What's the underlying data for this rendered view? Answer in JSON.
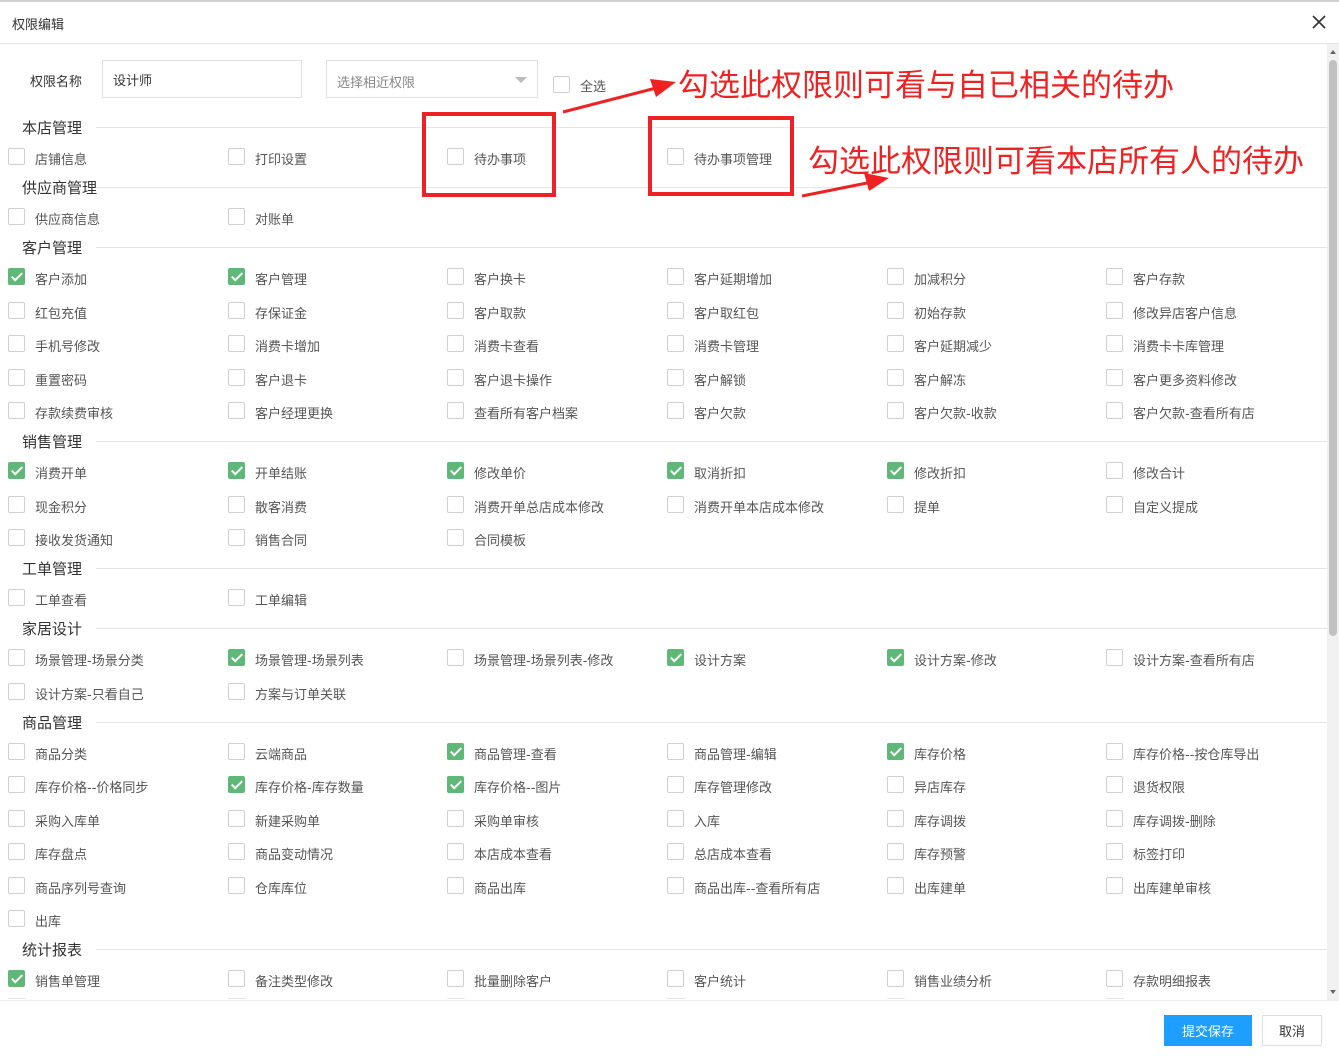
{
  "dialog": {
    "title": "权限编辑",
    "name_label": "权限名称",
    "name_value": "设计师",
    "select_placeholder": "选择相近权限",
    "select_all_label": "全选",
    "submit_label": "提交保存",
    "cancel_label": "取消"
  },
  "annotations": {
    "top": "勾选此权限则可看与自已相关的待办",
    "bottom": "勾选此权限则可看本店所有人的待办",
    "color": "#ee2222"
  },
  "colors": {
    "checked": "#5fb878",
    "primary_button": "#1e9fff"
  },
  "sections": [
    {
      "title": "本店管理",
      "rows": [
        [
          {
            "label": "店铺信息",
            "checked": false
          },
          {
            "label": "打印设置",
            "checked": false
          },
          {
            "label": "待办事项",
            "checked": false
          },
          {
            "label": "待办事项管理",
            "checked": false
          }
        ]
      ]
    },
    {
      "title": "供应商管理",
      "rows": [
        [
          {
            "label": "供应商信息",
            "checked": false
          },
          {
            "label": "对账单",
            "checked": false
          }
        ]
      ]
    },
    {
      "title": "客户管理",
      "rows": [
        [
          {
            "label": "客户添加",
            "checked": true
          },
          {
            "label": "客户管理",
            "checked": true
          },
          {
            "label": "客户换卡",
            "checked": false
          },
          {
            "label": "客户延期增加",
            "checked": false
          },
          {
            "label": "加减积分",
            "checked": false
          },
          {
            "label": "客户存款",
            "checked": false
          }
        ],
        [
          {
            "label": "红包充值",
            "checked": false
          },
          {
            "label": "存保证金",
            "checked": false
          },
          {
            "label": "客户取款",
            "checked": false
          },
          {
            "label": "客户取红包",
            "checked": false
          },
          {
            "label": "初始存款",
            "checked": false
          },
          {
            "label": "修改异店客户信息",
            "checked": false
          }
        ],
        [
          {
            "label": "手机号修改",
            "checked": false
          },
          {
            "label": "消费卡增加",
            "checked": false
          },
          {
            "label": "消费卡查看",
            "checked": false
          },
          {
            "label": "消费卡管理",
            "checked": false
          },
          {
            "label": "客户延期减少",
            "checked": false
          },
          {
            "label": "消费卡卡库管理",
            "checked": false
          }
        ],
        [
          {
            "label": "重置密码",
            "checked": false
          },
          {
            "label": "客户退卡",
            "checked": false
          },
          {
            "label": "客户退卡操作",
            "checked": false
          },
          {
            "label": "客户解锁",
            "checked": false
          },
          {
            "label": "客户解冻",
            "checked": false
          },
          {
            "label": "客户更多资料修改",
            "checked": false
          }
        ],
        [
          {
            "label": "存款续费审核",
            "checked": false
          },
          {
            "label": "客户经理更换",
            "checked": false
          },
          {
            "label": "查看所有客户档案",
            "checked": false
          },
          {
            "label": "客户欠款",
            "checked": false
          },
          {
            "label": "客户欠款-收款",
            "checked": false
          },
          {
            "label": "客户欠款-查看所有店",
            "checked": false
          }
        ]
      ]
    },
    {
      "title": "销售管理",
      "rows": [
        [
          {
            "label": "消费开单",
            "checked": true
          },
          {
            "label": "开单结账",
            "checked": true
          },
          {
            "label": "修改单价",
            "checked": true
          },
          {
            "label": "取消折扣",
            "checked": true
          },
          {
            "label": "修改折扣",
            "checked": true
          },
          {
            "label": "修改合计",
            "checked": false
          }
        ],
        [
          {
            "label": "现金积分",
            "checked": false
          },
          {
            "label": "散客消费",
            "checked": false
          },
          {
            "label": "消费开单总店成本修改",
            "checked": false
          },
          {
            "label": "消费开单本店成本修改",
            "checked": false
          },
          {
            "label": "提单",
            "checked": false
          },
          {
            "label": "自定义提成",
            "checked": false
          }
        ],
        [
          {
            "label": "接收发货通知",
            "checked": false
          },
          {
            "label": "销售合同",
            "checked": false
          },
          {
            "label": "合同模板",
            "checked": false
          }
        ]
      ]
    },
    {
      "title": "工单管理",
      "rows": [
        [
          {
            "label": "工单查看",
            "checked": false
          },
          {
            "label": "工单编辑",
            "checked": false
          }
        ]
      ]
    },
    {
      "title": "家居设计",
      "rows": [
        [
          {
            "label": "场景管理-场景分类",
            "checked": false
          },
          {
            "label": "场景管理-场景列表",
            "checked": true
          },
          {
            "label": "场景管理-场景列表-修改",
            "checked": false
          },
          {
            "label": "设计方案",
            "checked": true
          },
          {
            "label": "设计方案-修改",
            "checked": true
          },
          {
            "label": "设计方案-查看所有店",
            "checked": false
          }
        ],
        [
          {
            "label": "设计方案-只看自己",
            "checked": false
          },
          {
            "label": "方案与订单关联",
            "checked": false
          }
        ]
      ]
    },
    {
      "title": "商品管理",
      "rows": [
        [
          {
            "label": "商品分类",
            "checked": false
          },
          {
            "label": "云端商品",
            "checked": false
          },
          {
            "label": "商品管理-查看",
            "checked": true
          },
          {
            "label": "商品管理-编辑",
            "checked": false
          },
          {
            "label": "库存价格",
            "checked": true
          },
          {
            "label": "库存价格--按仓库导出",
            "checked": false
          }
        ],
        [
          {
            "label": "库存价格--价格同步",
            "checked": false
          },
          {
            "label": "库存价格-库存数量",
            "checked": true
          },
          {
            "label": "库存价格--图片",
            "checked": true
          },
          {
            "label": "库存管理修改",
            "checked": false
          },
          {
            "label": "异店库存",
            "checked": false
          },
          {
            "label": "退货权限",
            "checked": false
          }
        ],
        [
          {
            "label": "采购入库单",
            "checked": false
          },
          {
            "label": "新建采购单",
            "checked": false
          },
          {
            "label": "采购单审核",
            "checked": false
          },
          {
            "label": "入库",
            "checked": false
          },
          {
            "label": "库存调拨",
            "checked": false
          },
          {
            "label": "库存调拨-删除",
            "checked": false
          }
        ],
        [
          {
            "label": "库存盘点",
            "checked": false
          },
          {
            "label": "商品变动情况",
            "checked": false
          },
          {
            "label": "本店成本查看",
            "checked": false
          },
          {
            "label": "总店成本查看",
            "checked": false
          },
          {
            "label": "库存预警",
            "checked": false
          },
          {
            "label": "标签打印",
            "checked": false
          }
        ],
        [
          {
            "label": "商品序列号查询",
            "checked": false
          },
          {
            "label": "仓库库位",
            "checked": false
          },
          {
            "label": "商品出库",
            "checked": false
          },
          {
            "label": "商品出库--查看所有店",
            "checked": false
          },
          {
            "label": "出库建单",
            "checked": false
          },
          {
            "label": "出库建单审核",
            "checked": false
          }
        ],
        [
          {
            "label": "出库",
            "checked": false
          }
        ]
      ]
    },
    {
      "title": "统计报表",
      "rows": [
        [
          {
            "label": "销售单管理",
            "checked": true
          },
          {
            "label": "备注类型修改",
            "checked": false
          },
          {
            "label": "批量删除客户",
            "checked": false
          },
          {
            "label": "客户统计",
            "checked": false
          },
          {
            "label": "销售业绩分析",
            "checked": false
          },
          {
            "label": "存款明细报表",
            "checked": false
          }
        ]
      ]
    }
  ]
}
